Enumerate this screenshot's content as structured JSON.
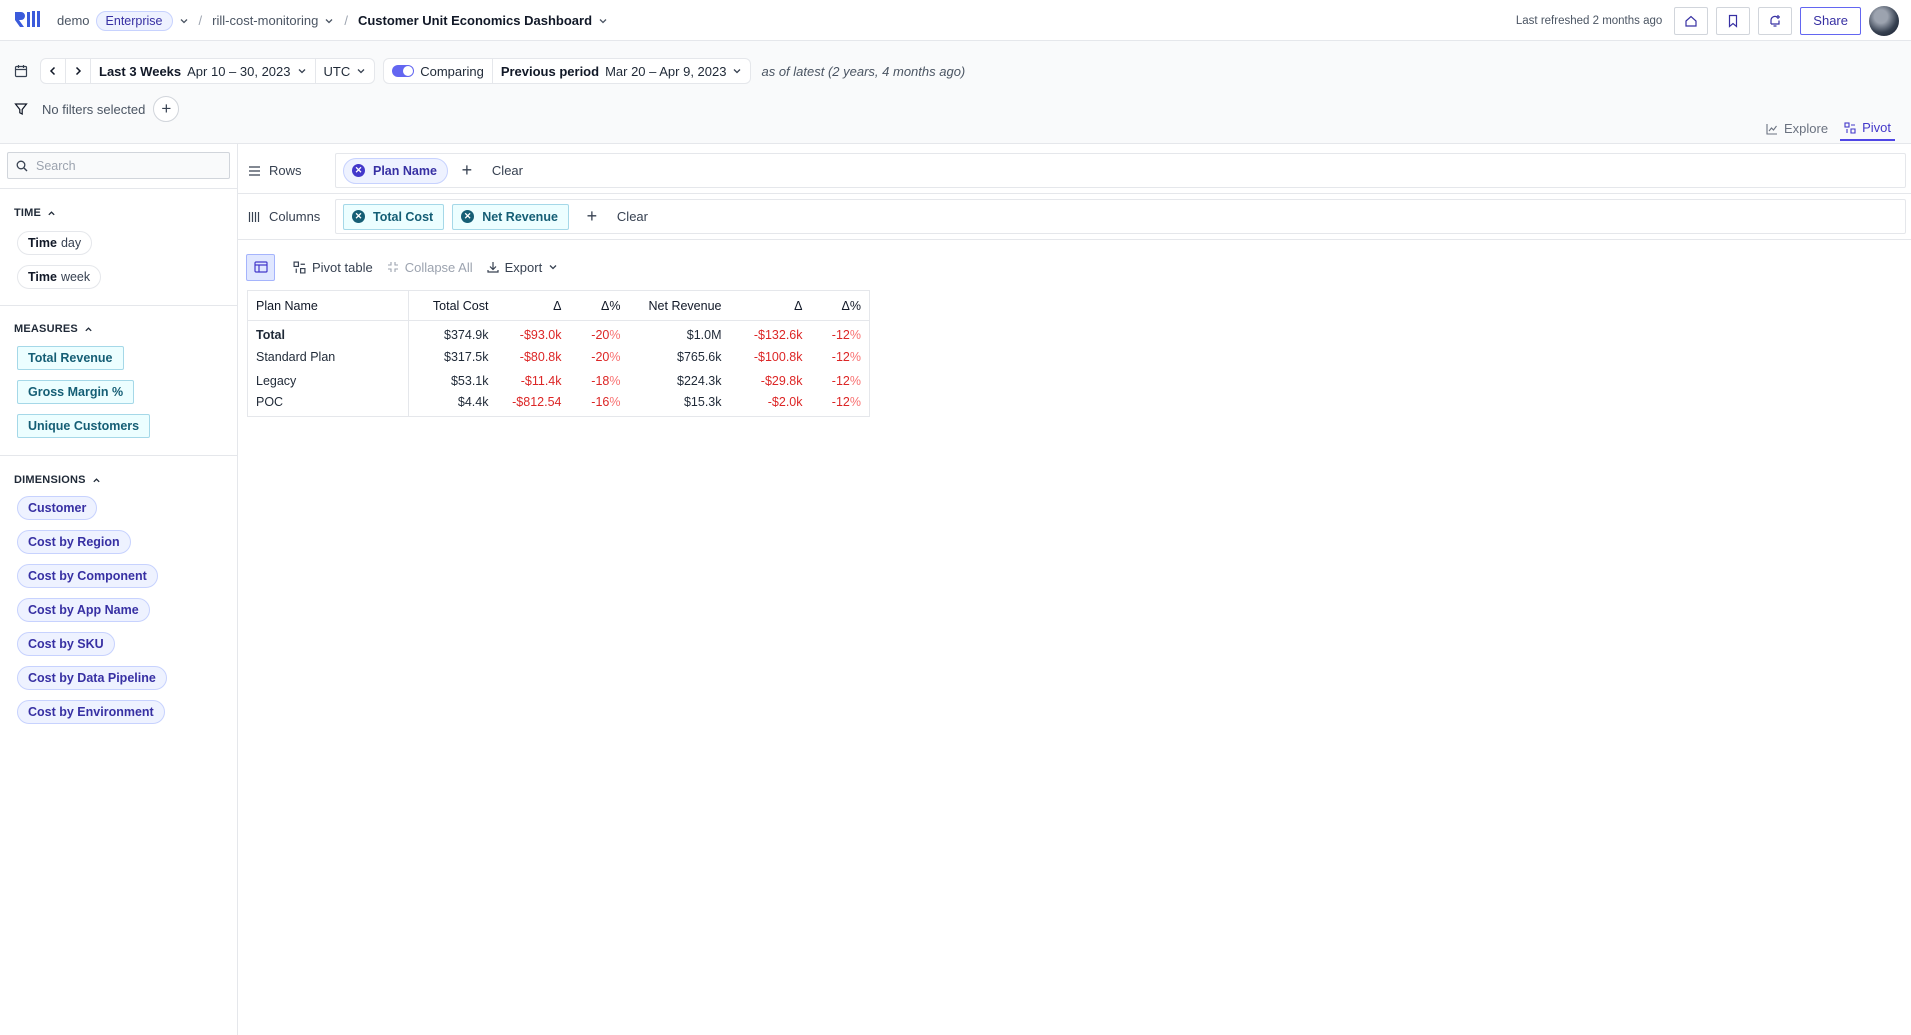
{
  "header": {
    "org": "demo",
    "plan_badge": "Enterprise",
    "project": "rill-cost-monitoring",
    "dashboard": "Customer Unit Economics Dashboard",
    "last_refreshed": "Last refreshed 2 months ago",
    "share_label": "Share"
  },
  "time_controls": {
    "range_label": "Last 3 Weeks",
    "range_dates": "Apr 10 – 30, 2023",
    "timezone": "UTC",
    "comparing_label": "Comparing",
    "comparison_label": "Previous period",
    "comparison_dates": "Mar 20 – Apr 9, 2023",
    "as_of": "as of latest (2 years, 4 months ago)"
  },
  "filters": {
    "empty_label": "No filters selected"
  },
  "view_tabs": {
    "explore": "Explore",
    "pivot": "Pivot"
  },
  "sidebar": {
    "search_placeholder": "Search",
    "time_title": "TIME",
    "time_items": [
      {
        "name": "Time",
        "grain": "day"
      },
      {
        "name": "Time",
        "grain": "week"
      }
    ],
    "measures_title": "MEASURES",
    "measures": [
      "Total Revenue",
      "Gross Margin %",
      "Unique Customers"
    ],
    "dimensions_title": "DIMENSIONS",
    "dimensions": [
      "Customer",
      "Cost by Region",
      "Cost by Component",
      "Cost by App Name",
      "Cost by SKU",
      "Cost by Data Pipeline",
      "Cost by Environment"
    ]
  },
  "shelves": {
    "rows_label": "Rows",
    "rows_pills": [
      "Plan Name"
    ],
    "columns_label": "Columns",
    "columns_pills": [
      "Total Cost",
      "Net Revenue"
    ],
    "clear_label": "Clear"
  },
  "toolbar": {
    "pivot_table": "Pivot table",
    "collapse_all": "Collapse All",
    "export": "Export"
  },
  "table": {
    "headers": [
      "Plan Name",
      "Total Cost",
      "Δ",
      "Δ%",
      "Net Revenue",
      "Δ",
      "Δ%"
    ],
    "rows": [
      {
        "name": "Total",
        "cost": "$374.9k",
        "cost_delta": "-$93.0k",
        "cost_pct": "-20",
        "rev": "$1.0M",
        "rev_delta": "-$132.6k",
        "rev_pct": "-12"
      },
      {
        "name": "Standard Plan",
        "cost": "$317.5k",
        "cost_delta": "-$80.8k",
        "cost_pct": "-20",
        "rev": "$765.6k",
        "rev_delta": "-$100.8k",
        "rev_pct": "-12"
      },
      {
        "name": "Legacy",
        "cost": "$53.1k",
        "cost_delta": "-$11.4k",
        "cost_pct": "-18",
        "rev": "$224.3k",
        "rev_delta": "-$29.8k",
        "rev_pct": "-12"
      },
      {
        "name": "POC",
        "cost": "$4.4k",
        "cost_delta": "-$812.54",
        "cost_pct": "-16",
        "rev": "$15.3k",
        "rev_delta": "-$2.0k",
        "rev_pct": "-12"
      }
    ],
    "pct_sign": "%"
  },
  "colors": {
    "accent": "#4f46e5",
    "measure_chip": "#ecfeff",
    "dimension_chip": "#eef2ff",
    "negative": "#dc2626"
  }
}
